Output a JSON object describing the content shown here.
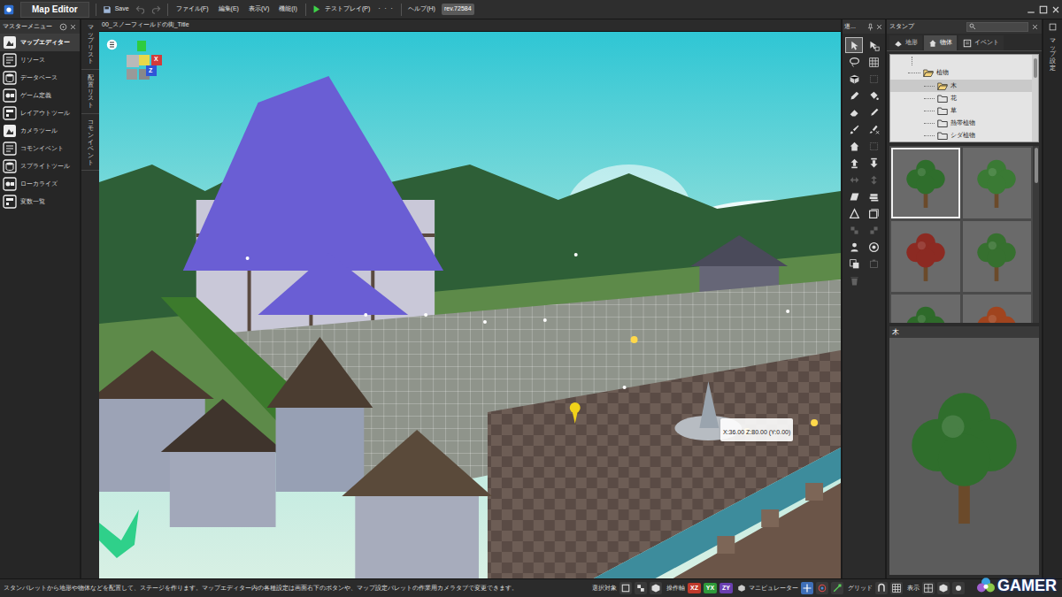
{
  "window": {
    "title": "Map Editor",
    "save": "Save",
    "revision": "rev.72584"
  },
  "menu": [
    {
      "label": "ファイル(F)"
    },
    {
      "label": "編集(E)"
    },
    {
      "label": "表示(V)"
    },
    {
      "label": "機能(I)"
    }
  ],
  "test_play": {
    "icon": "▶",
    "label": "テストプレイ(P)"
  },
  "more": "・・・",
  "help": {
    "label": "ヘルプ(H)"
  },
  "master_menu": {
    "title": "マスターメニュー",
    "items": [
      {
        "label": "マップエディター",
        "selected": true
      },
      {
        "label": "リソース",
        "selected": false
      },
      {
        "label": "データベース",
        "selected": false
      },
      {
        "label": "ゲーム定義",
        "selected": false
      },
      {
        "label": "レイアウトツール",
        "selected": false
      },
      {
        "label": "カメラツール",
        "selected": false
      },
      {
        "label": "コモンイベント",
        "selected": false
      },
      {
        "label": "スプライトツール",
        "selected": false
      },
      {
        "label": "ローカライズ",
        "selected": false
      },
      {
        "label": "変数一覧",
        "selected": false
      }
    ]
  },
  "side_tabs": [
    {
      "label": "マップリスト",
      "selected": false
    },
    {
      "label": "配置リスト",
      "selected": false
    },
    {
      "label": "コモンイベント",
      "selected": false
    }
  ],
  "viewport": {
    "tab": "00_スノーフィールドの街_Title",
    "gizmo": {
      "x": "X",
      "z": "Z"
    },
    "coordinate": "X:36.00 Z:80.00 (Y:0.00)"
  },
  "tools": {
    "title": "道...",
    "items": [
      {
        "selected": true,
        "disabled": false
      },
      {
        "selected": false,
        "disabled": false
      },
      {
        "selected": false,
        "disabled": false
      },
      {
        "selected": false,
        "disabled": false
      },
      {
        "selected": false,
        "disabled": false
      },
      {
        "selected": false,
        "disabled": true
      },
      {
        "selected": false,
        "disabled": false
      },
      {
        "selected": false,
        "disabled": false
      },
      {
        "selected": false,
        "disabled": false
      },
      {
        "selected": false,
        "disabled": false
      },
      {
        "selected": false,
        "disabled": false
      },
      {
        "selected": false,
        "disabled": false
      },
      {
        "selected": false,
        "disabled": false
      },
      {
        "selected": false,
        "disabled": true
      },
      {
        "selected": false,
        "disabled": false
      },
      {
        "selected": false,
        "disabled": false
      },
      {
        "selected": false,
        "disabled": true
      },
      {
        "selected": false,
        "disabled": true
      },
      {
        "selected": false,
        "disabled": false
      },
      {
        "selected": false,
        "disabled": false
      },
      {
        "selected": false,
        "disabled": false
      },
      {
        "selected": false,
        "disabled": false
      },
      {
        "selected": false,
        "disabled": true
      },
      {
        "selected": false,
        "disabled": true
      },
      {
        "selected": false,
        "disabled": false
      },
      {
        "selected": false,
        "disabled": false
      },
      {
        "selected": false,
        "disabled": false
      },
      {
        "selected": false,
        "disabled": true
      },
      {
        "selected": false,
        "disabled": true
      }
    ]
  },
  "stamp": {
    "title": "スタンプ",
    "tabs": [
      {
        "label": "地形",
        "selected": false
      },
      {
        "label": "物体",
        "selected": true
      },
      {
        "label": "イベント",
        "selected": false
      }
    ],
    "tree": {
      "label": "植物",
      "expanded": true,
      "children": [
        {
          "label": "木",
          "selected": true
        },
        {
          "label": "花",
          "selected": false
        },
        {
          "label": "草",
          "selected": false
        },
        {
          "label": "熱帯植物",
          "selected": false
        },
        {
          "label": "シダ植物",
          "selected": false
        }
      ]
    },
    "thumbnails": [
      {
        "color": "#2f6e2c",
        "selected": true
      },
      {
        "color": "#3a7a34",
        "selected": false
      },
      {
        "color": "#8c2a22",
        "selected": false
      },
      {
        "color": "#36702f",
        "selected": false
      },
      {
        "color": "#2e6a2a",
        "selected": false
      },
      {
        "color": "#a0441e",
        "selected": false
      }
    ],
    "preview": {
      "title": "木"
    }
  },
  "map_settings": {
    "label": "マップ設定"
  },
  "status_bar": {
    "message": "スタンパレットから地形や物体などを配置して、ステージを作ります。マップエディター内の各種設定は画面右下のボタンや、マップ設定パレットの作業用カメラタブで変更できます。",
    "selection": "選択対象",
    "axis": "操作軸",
    "axes": [
      {
        "label": "XZ",
        "color": "#c0392b"
      },
      {
        "label": "YX",
        "color": "#2f9a3a"
      },
      {
        "label": "ZY",
        "color": "#6a3fb0"
      }
    ],
    "manipulator": "マニピュレーター",
    "grid": "グリッド",
    "display": "表示"
  },
  "watermark": "GAMER"
}
